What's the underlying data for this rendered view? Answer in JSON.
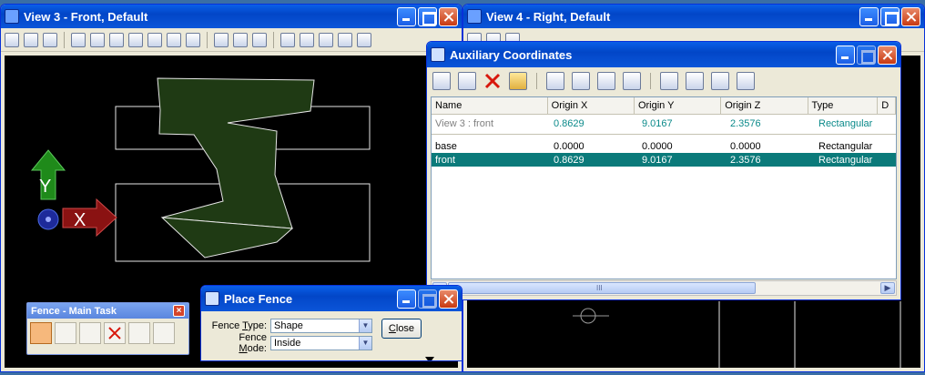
{
  "view3": {
    "title": "View 3 - Front, Default"
  },
  "view4": {
    "title": "View 4 - Right, Default"
  },
  "axes": {
    "y_label": "Y",
    "x_label": "X"
  },
  "aux": {
    "title": "Auxiliary Coordinates",
    "columns": [
      "Name",
      "Origin X",
      "Origin Y",
      "Origin Z",
      "Type",
      "D"
    ],
    "rows": [
      {
        "name": "View 3 : front",
        "x": "0.8629",
        "y": "9.0167",
        "z": "2.3576",
        "type": "Rectangular",
        "style": "view"
      },
      {
        "name": "base",
        "x": "0.0000",
        "y": "0.0000",
        "z": "0.0000",
        "type": "Rectangular",
        "style": "normal"
      },
      {
        "name": "front",
        "x": "0.8629",
        "y": "9.0167",
        "z": "2.3576",
        "type": "Rectangular",
        "style": "selected"
      }
    ],
    "scroll_grip": "III"
  },
  "fence_task": {
    "title": "Fence - Main Task"
  },
  "place_fence": {
    "title": "Place Fence",
    "type_label_pre": "Fence ",
    "type_label_u": "T",
    "type_label_post": "ype:",
    "type_value": "Shape",
    "mode_label_pre": "Fence ",
    "mode_label_u": "M",
    "mode_label_post": "ode:",
    "mode_value": "Inside",
    "close_u": "C",
    "close_rest": "lose"
  },
  "colors": {
    "accent": "#0b7a7a",
    "title_blue": "#0246c7",
    "shape_fill": "#1f3a14"
  }
}
